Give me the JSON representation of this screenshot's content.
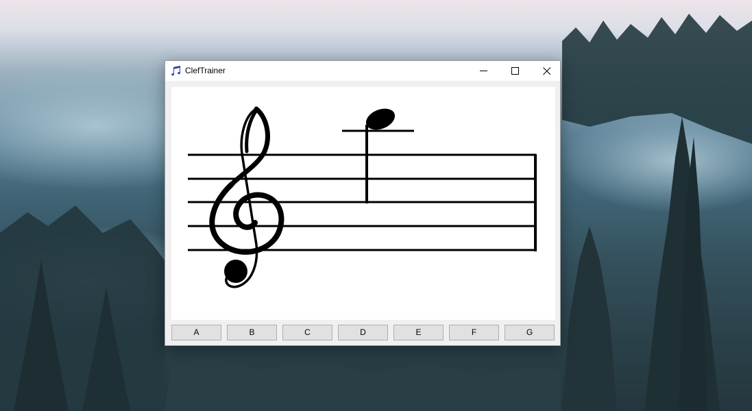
{
  "window": {
    "title": "ClefTrainer",
    "app_icon": "music-note-icon",
    "controls": [
      "minimize-icon",
      "maximize-icon",
      "close-icon"
    ]
  },
  "staff": {
    "clef": "treble",
    "note": "quarter",
    "ledger_lines_above": 1
  },
  "answers": [
    "A",
    "B",
    "C",
    "D",
    "E",
    "F",
    "G"
  ],
  "colors": {
    "window_bg": "#f0f0f0",
    "titlebar_bg": "#ffffff",
    "canvas_bg": "#ffffff",
    "button_bg": "#e1e1e1",
    "button_border": "#adadad",
    "icon_blue": "#2b3ea8",
    "ink": "#000000"
  }
}
